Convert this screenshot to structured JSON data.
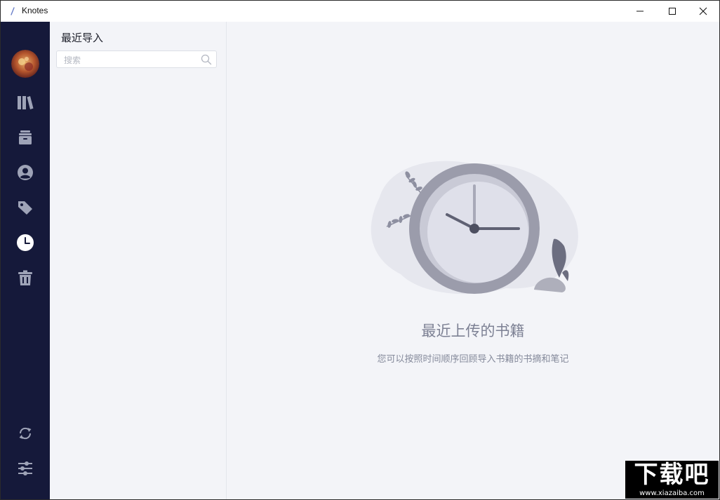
{
  "window": {
    "title": "Knotes",
    "controls": {
      "minimize": "minimize",
      "maximize": "maximize",
      "close": "close"
    }
  },
  "colors": {
    "rail_bg": "#15193a",
    "rail_icon": "#9ea3b7",
    "rail_icon_active": "#ffffff",
    "panel_bg": "#f3f4f8",
    "clock_ring": "#9b9cab"
  },
  "rail": {
    "items": [
      {
        "icon": "bookshelf-icon",
        "active": false
      },
      {
        "icon": "archive-box-icon",
        "active": false
      },
      {
        "icon": "user-circle-icon",
        "active": false
      },
      {
        "icon": "tag-icon",
        "active": false
      },
      {
        "icon": "clock-icon",
        "active": true
      },
      {
        "icon": "trash-icon",
        "active": false
      }
    ],
    "bottom": [
      {
        "icon": "sync-icon"
      },
      {
        "icon": "settings-sliders-icon"
      }
    ]
  },
  "panel": {
    "title": "最近导入",
    "search_placeholder": "搜索",
    "search_value": ""
  },
  "empty_state": {
    "title": "最近上传的书籍",
    "description": "您可以按照时间顺序回顾导入书籍的书摘和笔记"
  },
  "watermark": {
    "main": "下载吧",
    "url": "www.xiazaiba.com"
  }
}
